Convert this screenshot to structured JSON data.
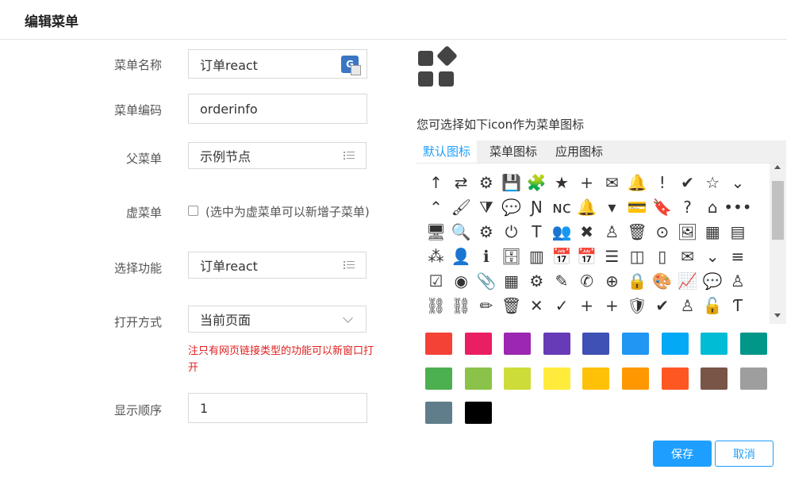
{
  "header": {
    "title": "编辑菜单"
  },
  "form": {
    "name": {
      "label": "菜单名称",
      "value": "订单react"
    },
    "code": {
      "label": "菜单编码",
      "value": "orderinfo"
    },
    "parent": {
      "label": "父菜单",
      "value": "示例节点"
    },
    "virtual": {
      "label": "虚菜单",
      "checked": false,
      "desc": "(选中为虚菜单可以新增子菜单)"
    },
    "function": {
      "label": "选择功能",
      "value": "订单react"
    },
    "open_mode": {
      "label": "打开方式",
      "value": "当前页面",
      "note": "注只有网页链接类型的功能可以新窗口打开"
    },
    "order": {
      "label": "显示顺序",
      "value": "1"
    }
  },
  "icon_picker": {
    "selected_icon": "apps-grid-icon",
    "hint": "您可选择如下icon作为菜单图标",
    "tabs": [
      {
        "label": "默认图标",
        "active": true
      },
      {
        "label": "菜单图标",
        "active": false
      },
      {
        "label": "应用图标",
        "active": false
      }
    ],
    "icons": [
      [
        "↑",
        "⇄",
        "⚙",
        "💾",
        "🧩",
        "★",
        "+",
        "✉",
        "🔔",
        "!",
        "✔",
        "☆",
        "⌄"
      ],
      [
        "⌃",
        "🖌",
        "⧩",
        "💬",
        "Ɲ",
        "ɴc",
        "🔔",
        "▾",
        "💳",
        "🔖",
        "?",
        "⌂",
        "•••"
      ],
      [
        "🖥",
        "🔍",
        "⚙",
        "⏻",
        "T",
        "👥",
        "✖",
        "♙",
        "🗑",
        "⊙",
        "🖼",
        "▦",
        "▤"
      ],
      [
        "⁂",
        "👤",
        "ℹ",
        "🗄",
        "▥",
        "📅",
        "📅",
        "☰",
        "◫",
        "▯",
        "✉",
        "⌄",
        "≡"
      ],
      [
        "☑",
        "◉",
        "📎",
        "▦",
        "⚙",
        "✎",
        "✆",
        "⊕",
        "🔒",
        "🎨",
        "📈",
        "💬",
        "♙"
      ],
      [
        "⛓",
        "⛓",
        "✏",
        "🗑",
        "✕",
        "✓",
        "+",
        "+",
        "🛡",
        "✔",
        "♙",
        "🔓",
        "Ƭ"
      ]
    ],
    "colors": [
      "#f44336",
      "#e91e63",
      "#9c27b0",
      "#673ab7",
      "#3f51b5",
      "#2196f3",
      "#03a9f4",
      "#00bcd4",
      "#009688",
      "#4caf50",
      "#8bc34a",
      "#cddc39",
      "#ffeb3b",
      "#ffc107",
      "#ff9800",
      "#ff5722",
      "#795548",
      "#9e9e9e",
      "#607d8b",
      "#000000"
    ]
  },
  "actions": {
    "save": "保存",
    "cancel": "取消"
  }
}
